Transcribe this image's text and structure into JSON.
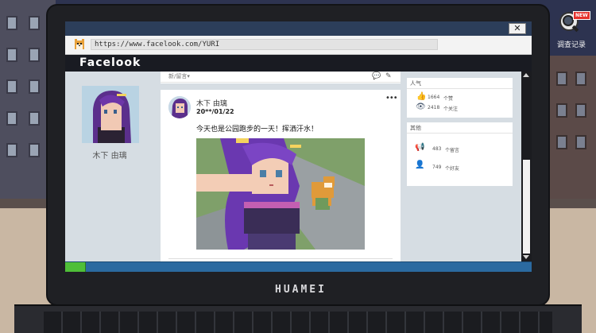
{
  "browser": {
    "url": "https://www.facelook.com/YURI",
    "close_label": "✕"
  },
  "site": {
    "title": "Facelook"
  },
  "profile": {
    "name": "木下 由璃"
  },
  "feed": {
    "sort_label": "新/留言▾",
    "post": {
      "author": "木下 由璃",
      "date": "20**/01/22",
      "text": "今天也是公园跑步的一天！挥洒汗水！",
      "menu": "•••"
    }
  },
  "sidebar": {
    "popularity": {
      "title": "人气",
      "likes_count": "1664",
      "likes_label": "个赞",
      "follows_count": "2418",
      "follows_label": "个关注"
    },
    "others": {
      "title": "其他",
      "comments_count": "483",
      "comments_label": "个留言",
      "friends_count": "749",
      "friends_label": "个好友"
    }
  },
  "laptop": {
    "brand": "HUAMEI"
  },
  "history": {
    "badge": "NEW",
    "label": "调查记录"
  },
  "colors": {
    "browser_bar": "#2c3e5a",
    "site_header": "#191b22",
    "taskbar": "#2b6aa0",
    "start": "#4fbf38",
    "badge": "#e4322d"
  }
}
